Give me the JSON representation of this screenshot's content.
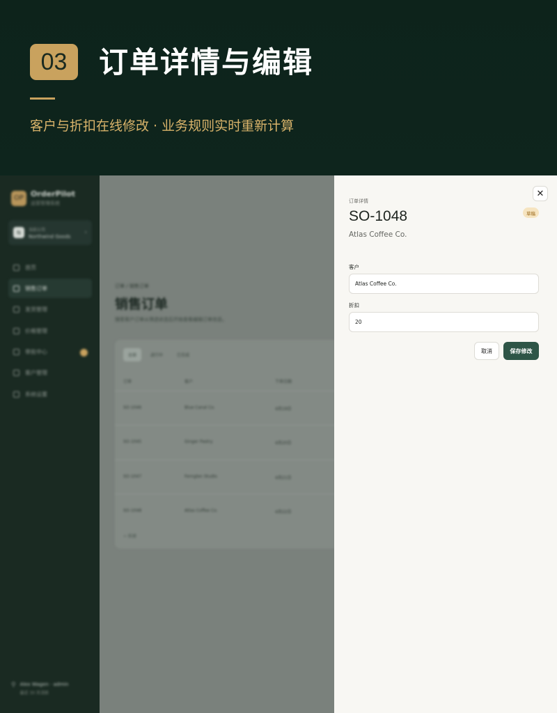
{
  "hero": {
    "number": "03",
    "title": "订单详情与编辑",
    "subtitle": "客户与折扣在线修改 · 业务规则实时重新计算"
  },
  "sidebar": {
    "brand": {
      "logo": "OP",
      "name": "OrderPilot",
      "tagline": "运营管理系统"
    },
    "tenant": {
      "logo": "N",
      "line1": "当前公司",
      "line2": "Northwind Goods"
    },
    "nav": [
      {
        "label": "首页",
        "icon": "home-icon",
        "active": false
      },
      {
        "label": "销售订单",
        "icon": "cart-icon",
        "active": true
      },
      {
        "label": "发货管理",
        "icon": "truck-icon",
        "active": false
      },
      {
        "label": "价格管理",
        "icon": "tag-icon",
        "active": false
      },
      {
        "label": "审批中心",
        "icon": "approval-icon",
        "active": false,
        "badge": true
      },
      {
        "label": "客户管理",
        "icon": "users-icon",
        "active": false
      },
      {
        "label": "系统设置",
        "icon": "gear-icon",
        "active": false
      }
    ],
    "user": {
      "line1": "Alex Wagen · admin",
      "line2": "最近 30 天活跃"
    }
  },
  "main": {
    "breadcrumb": "订单 / 销售订单",
    "title": "销售订单",
    "description": "搜索客户订单从筛选状态后开始查看编辑订单信息。",
    "tabs": [
      "全部",
      "进行中",
      "已完成"
    ],
    "columns": [
      "订单",
      "客户",
      "下单日期"
    ],
    "rows": [
      [
        "SO-1046",
        "Blue Canal Co.",
        "4月19日"
      ],
      [
        "SO-1045",
        "Ginger Pastry",
        "4月20日"
      ],
      [
        "SO-1047",
        "Fernglen Studio",
        "4月21日"
      ],
      [
        "SO-1048",
        "Atlas Coffee Co.",
        "4月22日"
      ]
    ],
    "add_row": "+ 新建"
  },
  "drawer": {
    "eyebrow": "订单详情",
    "order_id": "SO-1048",
    "customer_display": "Atlas Coffee Co.",
    "status": "草稿",
    "customer_label": "客户",
    "customer_value": "Atlas Coffee Co.",
    "discount_label": "折扣",
    "discount_value": "20",
    "close_glyph": "✕",
    "cancel_label": "取消",
    "save_label": "保存修改"
  },
  "colors": {
    "accent_gold": "#c9a25e",
    "primary_green": "#2e5547",
    "hero_bg": "#0d231b"
  }
}
